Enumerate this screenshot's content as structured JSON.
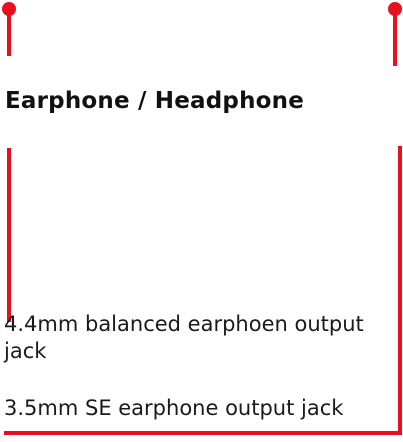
{
  "heading": "Earphone / Headphone",
  "jacks": [
    {
      "label": "4.4mm balanced earphoen output jack"
    },
    {
      "label": "3.5mm SE earphone output jack"
    }
  ],
  "colors": {
    "callout_line": "#e8101e",
    "text": "#1a1a1a",
    "background": "#ffffff"
  }
}
